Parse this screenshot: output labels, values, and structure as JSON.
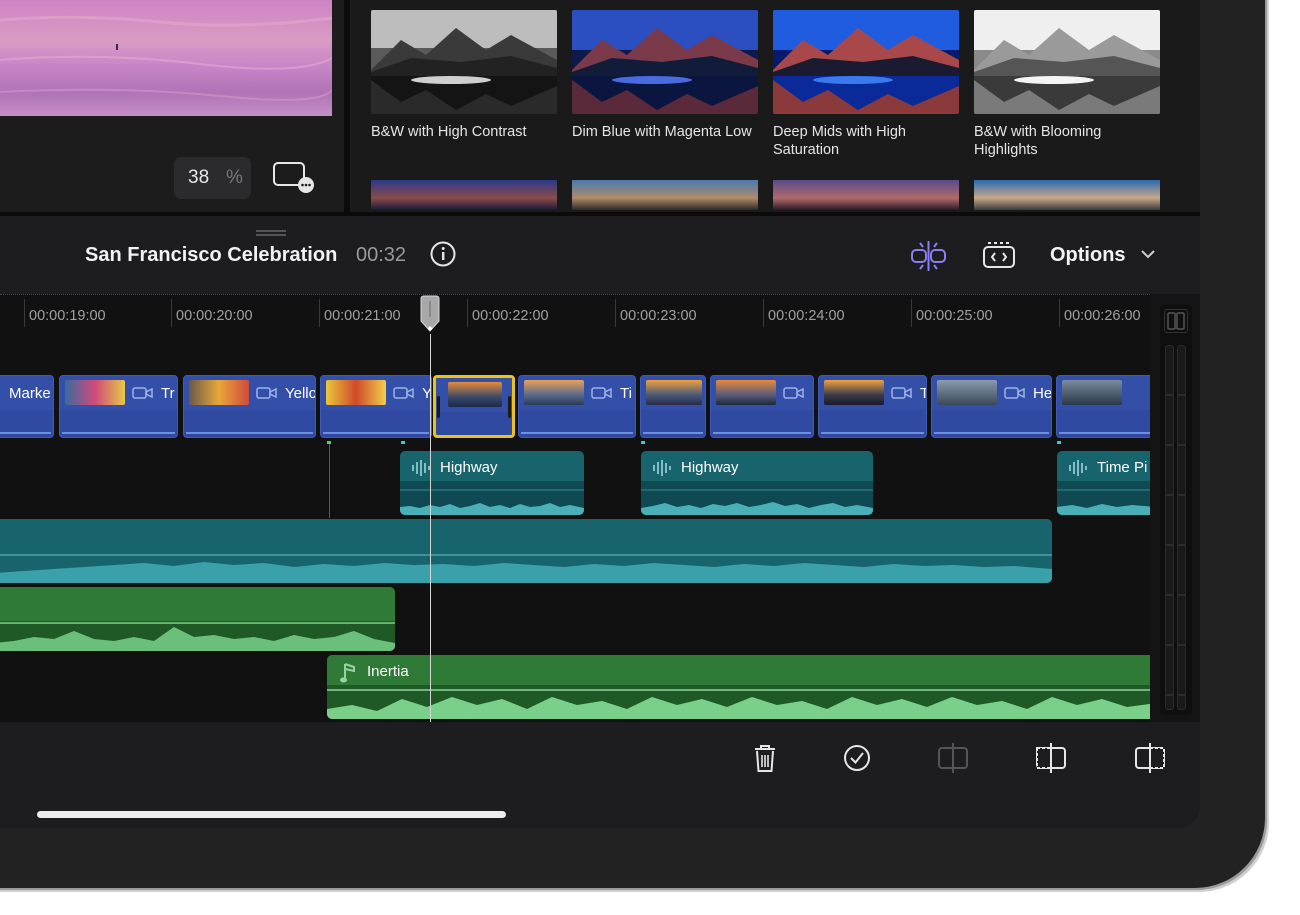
{
  "viewer": {
    "zoom_value": "38",
    "zoom_unit": "%",
    "display_icon": "display-options-icon"
  },
  "browser": {
    "tiles": [
      {
        "label": "B&W with High Contrast"
      },
      {
        "label": "Dim Blue with Magenta Low"
      },
      {
        "label": "Deep Mids with High Saturation"
      },
      {
        "label": "B&W with Blooming Highlights"
      }
    ]
  },
  "project": {
    "title": "San Francisco Celebration",
    "duration": "00:32",
    "options_label": "Options"
  },
  "ruler": [
    "00:00:19:00",
    "00:00:20:00",
    "00:00:21:00",
    "00:00:22:00",
    "00:00:23:00",
    "00:00:24:00",
    "00:00:25:00",
    "00:00:26:00"
  ],
  "video_clips": [
    {
      "label": "Marke"
    },
    {
      "label": "Tr"
    },
    {
      "label": "Yello"
    },
    {
      "label": "Y"
    },
    {
      "label": ""
    },
    {
      "label": "Ti"
    },
    {
      "label": ""
    },
    {
      "label": ""
    },
    {
      "label": "T"
    },
    {
      "label": "He"
    },
    {
      "label": ""
    }
  ],
  "audio_clips": [
    {
      "label": "Highway"
    },
    {
      "label": "Highway"
    },
    {
      "label": "Time Pi"
    },
    {
      "label": "Inertia"
    }
  ],
  "colors": {
    "video_clip": "#2f4aa0",
    "audio_clip_teal": "#17646d",
    "music_clip_green": "#2f7a36",
    "selection": "#e9c21a",
    "snap_accent": "#8b7df2"
  },
  "toolbar_icons": [
    "trash-icon",
    "checkmark-icon",
    "split-icon",
    "trim-start-icon",
    "trim-end-icon"
  ]
}
